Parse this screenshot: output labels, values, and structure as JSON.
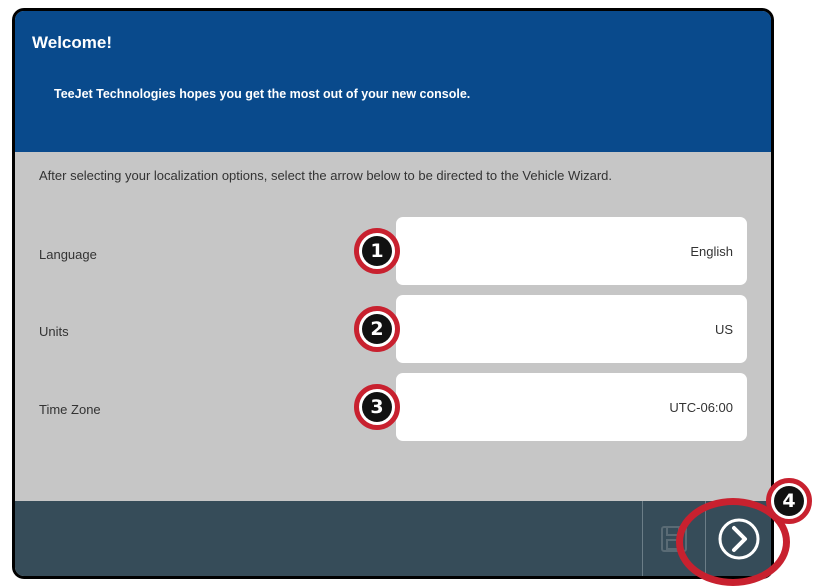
{
  "header": {
    "title": "Welcome!",
    "subtitle": "TeeJet Technologies hopes you get the most out of your new console."
  },
  "intro": "After selecting your localization options, select the arrow below to be directed to the Vehicle Wizard.",
  "settings": [
    {
      "label": "Language",
      "value": "English",
      "callout": "1"
    },
    {
      "label": "Units",
      "value": "US",
      "callout": "2"
    },
    {
      "label": "Time Zone",
      "value": "UTC-06:00",
      "callout": "3"
    }
  ],
  "footer": {
    "next_callout": "4",
    "save_icon": "save-icon",
    "next_icon": "chevron-right-icon"
  },
  "colors": {
    "header": "#094a8c",
    "body": "#c6c6c6",
    "footer": "#364c59",
    "callout_ring": "#c8212f"
  }
}
